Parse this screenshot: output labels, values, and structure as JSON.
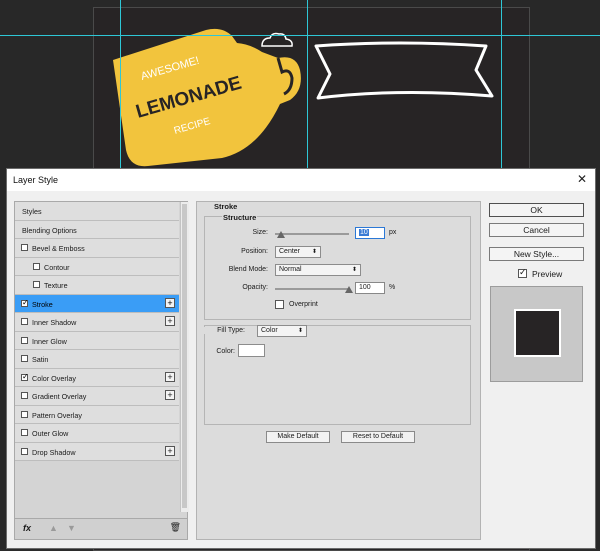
{
  "artwork": {
    "label_top": "AWESOME!",
    "label_main": "LEMONADE",
    "label_bottom": "RECIPE",
    "colors": {
      "lemon": "#f2c43d",
      "dark": "#272425",
      "guide": "#2ec7d6"
    }
  },
  "dialog": {
    "title": "Layer Style",
    "close_icon": "close-icon",
    "styles_list": [
      {
        "label": "Styles",
        "checkbox": false,
        "checked": false,
        "plus": false,
        "selected": false,
        "indent": false
      },
      {
        "label": "Blending Options",
        "checkbox": false,
        "checked": false,
        "plus": false,
        "selected": false,
        "indent": false
      },
      {
        "label": "Bevel & Emboss",
        "checkbox": true,
        "checked": false,
        "plus": false,
        "selected": false,
        "indent": false
      },
      {
        "label": "Contour",
        "checkbox": true,
        "checked": false,
        "plus": false,
        "selected": false,
        "indent": true
      },
      {
        "label": "Texture",
        "checkbox": true,
        "checked": false,
        "plus": false,
        "selected": false,
        "indent": true
      },
      {
        "label": "Stroke",
        "checkbox": true,
        "checked": true,
        "plus": true,
        "selected": true,
        "indent": false
      },
      {
        "label": "Inner Shadow",
        "checkbox": true,
        "checked": false,
        "plus": true,
        "selected": false,
        "indent": false
      },
      {
        "label": "Inner Glow",
        "checkbox": true,
        "checked": false,
        "plus": false,
        "selected": false,
        "indent": false
      },
      {
        "label": "Satin",
        "checkbox": true,
        "checked": false,
        "plus": false,
        "selected": false,
        "indent": false
      },
      {
        "label": "Color Overlay",
        "checkbox": true,
        "checked": true,
        "plus": true,
        "selected": false,
        "indent": false
      },
      {
        "label": "Gradient Overlay",
        "checkbox": true,
        "checked": false,
        "plus": true,
        "selected": false,
        "indent": false
      },
      {
        "label": "Pattern Overlay",
        "checkbox": true,
        "checked": false,
        "plus": false,
        "selected": false,
        "indent": false
      },
      {
        "label": "Outer Glow",
        "checkbox": true,
        "checked": false,
        "plus": false,
        "selected": false,
        "indent": false
      },
      {
        "label": "Drop Shadow",
        "checkbox": true,
        "checked": false,
        "plus": true,
        "selected": false,
        "indent": false
      }
    ],
    "footer": {
      "fx_label": "fx"
    },
    "stroke": {
      "section_title": "Stroke",
      "structure_title": "Structure",
      "size_label": "Size:",
      "size_value": "10",
      "size_unit": "px",
      "position_label": "Position:",
      "position_value": "Center",
      "blend_label": "Blend Mode:",
      "blend_value": "Normal",
      "opacity_label": "Opacity:",
      "opacity_value": "100",
      "opacity_unit": "%",
      "overprint_label": "Overprint",
      "fill_type_label": "Fill Type:",
      "fill_type_value": "Color",
      "color_label": "Color:",
      "stroke_color": "#ffffff",
      "make_default": "Make Default",
      "reset_default": "Reset to Default"
    },
    "buttons": {
      "ok": "OK",
      "cancel": "Cancel",
      "new_style": "New Style...",
      "preview_label": "Preview"
    },
    "preview_color": "#272425"
  }
}
